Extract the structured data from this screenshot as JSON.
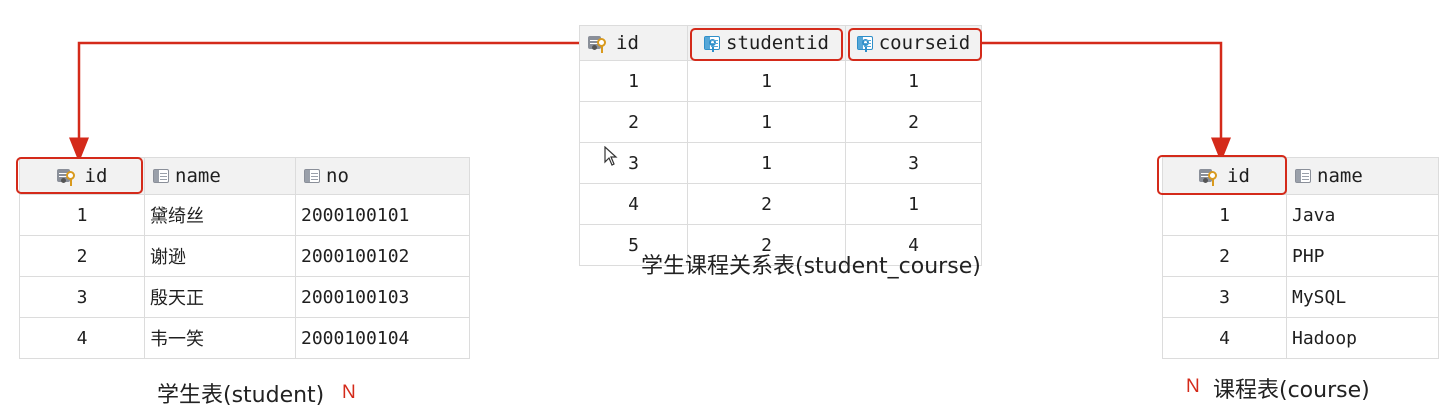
{
  "student_course": {
    "caption": "学生课程关系表(student_course)",
    "columns": [
      {
        "label": "id",
        "icon": "primary-key-icon"
      },
      {
        "label": "studentid",
        "icon": "foreign-key-icon"
      },
      {
        "label": "courseid",
        "icon": "foreign-key-icon"
      }
    ],
    "rows": [
      [
        "1",
        "1",
        "1"
      ],
      [
        "2",
        "1",
        "2"
      ],
      [
        "3",
        "1",
        "3"
      ],
      [
        "4",
        "2",
        "1"
      ],
      [
        "5",
        "2",
        "4"
      ]
    ]
  },
  "student": {
    "caption": "学生表(student)",
    "cardinality": "N",
    "columns": [
      {
        "label": "id",
        "icon": "primary-key-icon"
      },
      {
        "label": "name",
        "icon": "column-icon"
      },
      {
        "label": "no",
        "icon": "column-icon"
      }
    ],
    "rows": [
      [
        "1",
        "黛绮丝",
        "2000100101"
      ],
      [
        "2",
        "谢逊",
        "2000100102"
      ],
      [
        "3",
        "殷天正",
        "2000100103"
      ],
      [
        "4",
        "韦一笑",
        "2000100104"
      ]
    ]
  },
  "course": {
    "caption": "课程表(course)",
    "cardinality": "N",
    "columns": [
      {
        "label": "id",
        "icon": "primary-key-icon"
      },
      {
        "label": "name",
        "icon": "column-icon"
      }
    ],
    "rows": [
      [
        "1",
        "Java"
      ],
      [
        "2",
        "PHP"
      ],
      [
        "3",
        "MySQL"
      ],
      [
        "4",
        "Hadoop"
      ]
    ]
  },
  "colors": {
    "highlight": "#d42a1a",
    "header_bg": "#f2f2f2",
    "border": "#dcdcdc"
  }
}
